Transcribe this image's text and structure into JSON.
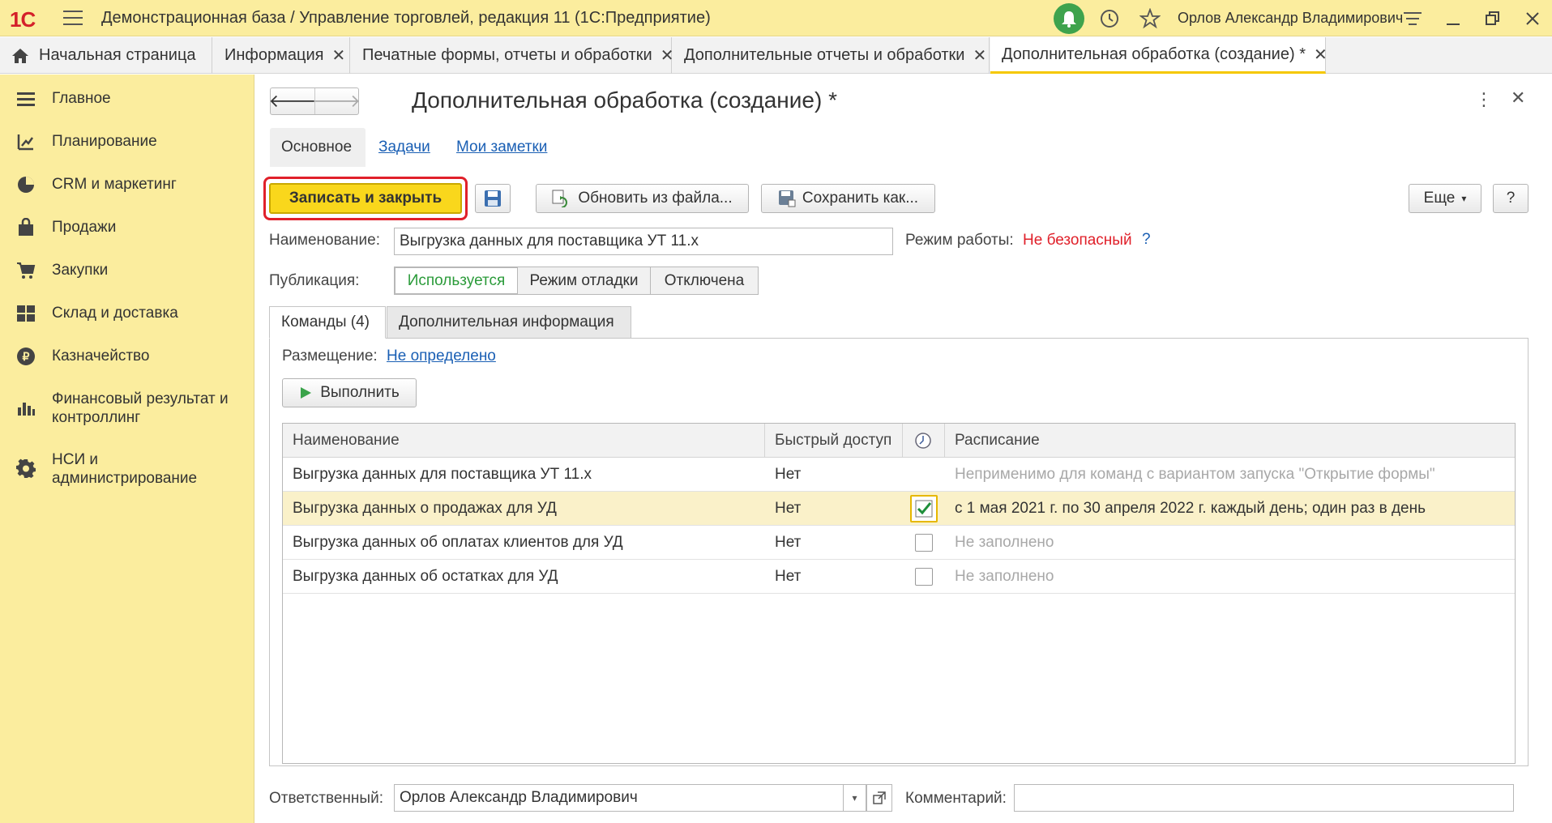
{
  "app": {
    "logo": "1С",
    "title": "Демонстрационная база / Управление торговлей, редакция 11  (1С:Предприятие)",
    "user": "Орлов Александр Владимирович"
  },
  "tabs": [
    {
      "label": "Начальная страница"
    },
    {
      "label": "Информация"
    },
    {
      "label": "Печатные формы, отчеты и обработки"
    },
    {
      "label": "Дополнительные отчеты и обработки"
    },
    {
      "label": "Дополнительная обработка (создание) *"
    }
  ],
  "sidebar": {
    "items": [
      {
        "label": "Главное",
        "icon": "menu-icon"
      },
      {
        "label": "Планирование",
        "icon": "planning-icon"
      },
      {
        "label": "CRM и маркетинг",
        "icon": "pie-icon"
      },
      {
        "label": "Продажи",
        "icon": "bag-icon"
      },
      {
        "label": "Закупки",
        "icon": "cart-icon"
      },
      {
        "label": "Склад и доставка",
        "icon": "grid-icon"
      },
      {
        "label": "Казначейство",
        "icon": "ruble-icon"
      },
      {
        "label": "Финансовый результат и контроллинг",
        "icon": "bars-icon"
      },
      {
        "label": "НСИ и администрирование",
        "icon": "gear-icon"
      }
    ]
  },
  "form": {
    "title": "Дополнительная обработка (создание) *",
    "tabs": [
      {
        "label": "Основное"
      },
      {
        "label": "Задачи"
      },
      {
        "label": "Мои заметки"
      }
    ],
    "toolbar": {
      "save_close": "Записать и закрыть",
      "update_from_file": "Обновить из файла...",
      "save_as": "Сохранить как...",
      "more": "Еще",
      "help": "?"
    },
    "name_label": "Наименование:",
    "name_value": "Выгрузка данных для поставщика УТ 11.х",
    "mode_label": "Режим работы:",
    "mode_value": "Не безопасный",
    "mode_help": "?",
    "publication_label": "Публикация:",
    "publication_options": [
      "Используется",
      "Режим отладки",
      "Отключена"
    ],
    "publication_selected": "Используется",
    "panel_tabs": [
      {
        "label": "Команды (4)"
      },
      {
        "label": "Дополнительная информация"
      }
    ],
    "placement_label": "Размещение:",
    "placement_value": "Не определено",
    "execute_label": "Выполнить",
    "grid": {
      "columns": [
        "Наименование",
        "Быстрый доступ",
        "",
        "Расписание"
      ],
      "rows": [
        {
          "name": "Выгрузка данных для поставщика УТ 11.х",
          "quick": "Нет",
          "scheduled": null,
          "schedule": "Неприменимо для команд с вариантом запуска \"Открытие формы\"",
          "muted": true
        },
        {
          "name": "Выгрузка данных о продажах для УД",
          "quick": "Нет",
          "scheduled": true,
          "schedule": "с 1 мая 2021 г. по 30 апреля 2022 г. каждый день; один раз в день",
          "muted": false
        },
        {
          "name": "Выгрузка данных об оплатах клиентов для УД",
          "quick": "Нет",
          "scheduled": false,
          "schedule": "Не заполнено",
          "muted": true
        },
        {
          "name": "Выгрузка данных об остатках для УД",
          "quick": "Нет",
          "scheduled": false,
          "schedule": "Не заполнено",
          "muted": true
        }
      ]
    },
    "responsible_label": "Ответственный:",
    "responsible_value": "Орлов Александр Владимирович",
    "comment_label": "Комментарий:",
    "comment_value": ""
  },
  "colors": {
    "accent_yellow": "#fbed9e",
    "primary_button": "#f9d71c",
    "danger": "#e0202a",
    "link": "#1a5fb4",
    "ok_green": "#2b9b3a"
  }
}
